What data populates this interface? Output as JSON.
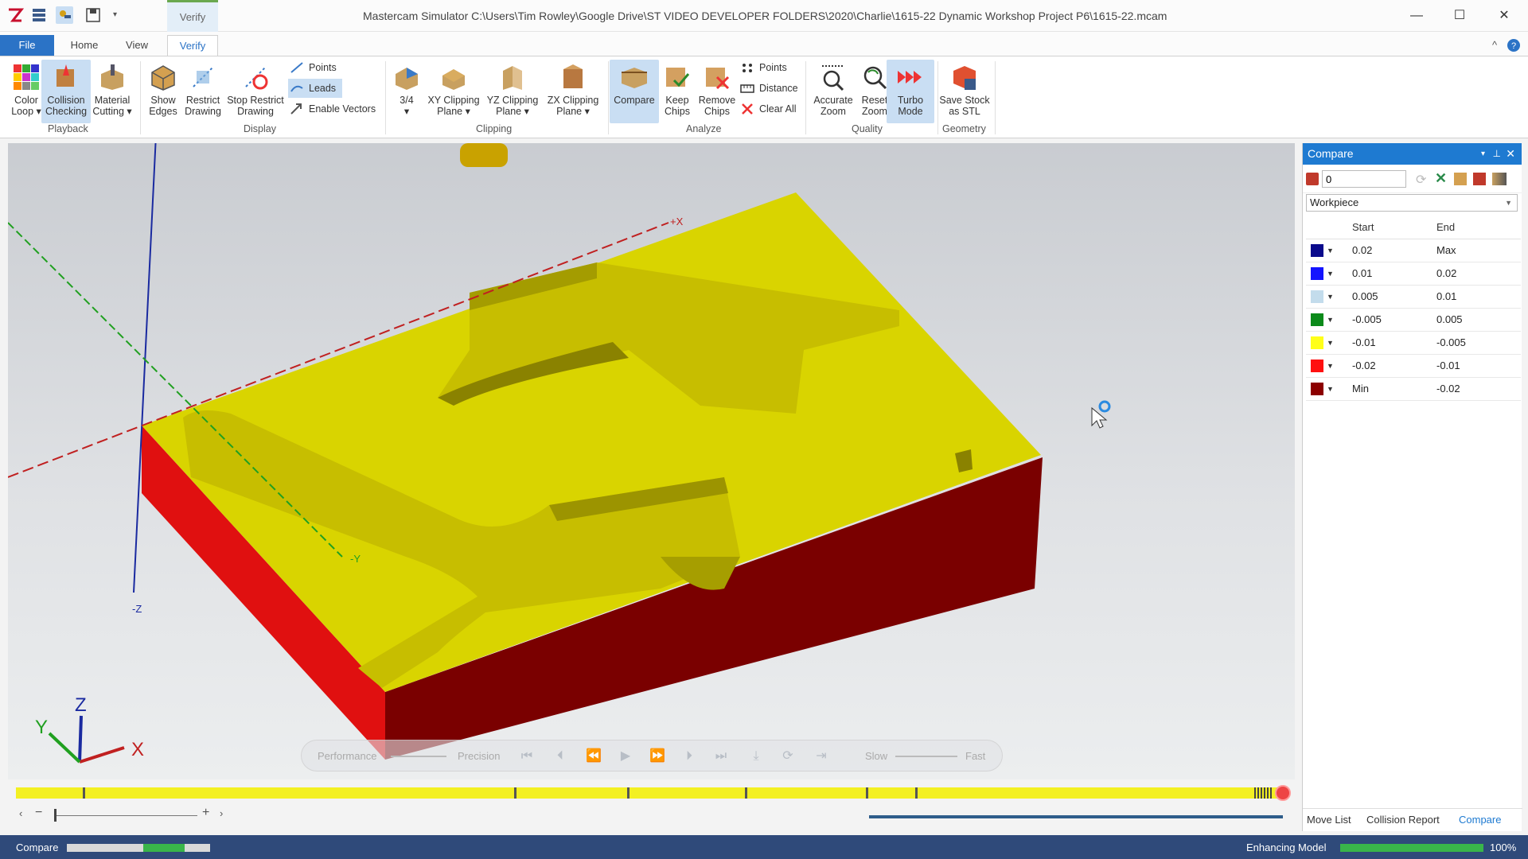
{
  "window": {
    "title": "Mastercam Simulator  C:\\Users\\Tim Rowley\\Google Drive\\ST VIDEO DEVELOPER FOLDERS\\2020\\Charlie\\1615-22 Dynamic Workshop Project P6\\1615-22.mcam",
    "context_tab": "Verify",
    "minimize": "—",
    "maximize": "☐",
    "close": "✕"
  },
  "tabs": [
    "File",
    "Home",
    "View",
    "Verify"
  ],
  "ribbon": {
    "playback": {
      "label": "Playback",
      "color_loop": "Color\nLoop ▾",
      "collision_checking": "Collision\nChecking",
      "material_cutting": "Material\nCutting ▾"
    },
    "display": {
      "label": "Display",
      "show_edges": "Show\nEdges",
      "restrict_drawing": "Restrict\nDrawing",
      "stop_restrict_drawing": "Stop Restrict\nDrawing",
      "points": "Points",
      "leads": "Leads",
      "enable_vectors": "Enable Vectors"
    },
    "clipping": {
      "label": "Clipping",
      "three_quarter": "3/4\n▾",
      "xy": "XY Clipping\nPlane ▾",
      "yz": "YZ Clipping\nPlane ▾",
      "zx": "ZX Clipping\nPlane ▾"
    },
    "analyze": {
      "label": "Analyze",
      "compare": "Compare",
      "keep_chips": "Keep\nChips",
      "remove_chips": "Remove\nChips",
      "points": "Points",
      "distance": "Distance",
      "clear_all": "Clear All"
    },
    "quality": {
      "label": "Quality",
      "accurate_zoom": "Accurate\nZoom",
      "reset_zoom": "Reset\nZoom",
      "turbo_mode": "Turbo\nMode"
    },
    "geometry": {
      "label": "Geometry",
      "save_stock": "Save Stock\nas STL"
    }
  },
  "viewport": {
    "axis_labels": {
      "x": "+X",
      "y": "-Y",
      "z": "-Z"
    },
    "triad": {
      "x": "X",
      "y": "Y",
      "z": "Z"
    },
    "colors": {
      "top": "#d9d400",
      "side_left": "#e01010",
      "side_right": "#7a0000",
      "pocket": "#b5ad00"
    }
  },
  "playbar": {
    "performance": "Performance",
    "precision": "Precision",
    "slow": "Slow",
    "fast": "Fast"
  },
  "compare_panel": {
    "title": "Compare",
    "value": "0",
    "target": "Workpiece",
    "headers": {
      "start": "Start",
      "end": "End"
    },
    "rows": [
      {
        "color": "#0a0a8c",
        "start": "0.02",
        "end": "Max"
      },
      {
        "color": "#1414ff",
        "start": "0.01",
        "end": "0.02"
      },
      {
        "color": "#c3dcec",
        "start": "0.005",
        "end": "0.01"
      },
      {
        "color": "#0b8a1a",
        "start": "-0.005",
        "end": "0.005"
      },
      {
        "color": "#ffff19",
        "start": "-0.01",
        "end": "-0.005"
      },
      {
        "color": "#ff1010",
        "start": "-0.02",
        "end": "-0.01"
      },
      {
        "color": "#8c0000",
        "start": "Min",
        "end": "-0.02"
      }
    ],
    "bottom_tabs": [
      "Move List",
      "Collision Report",
      "Compare"
    ]
  },
  "status": {
    "left": "Compare",
    "right": "Enhancing Model",
    "percent": "100%",
    "enhance_progress": 1.0
  }
}
